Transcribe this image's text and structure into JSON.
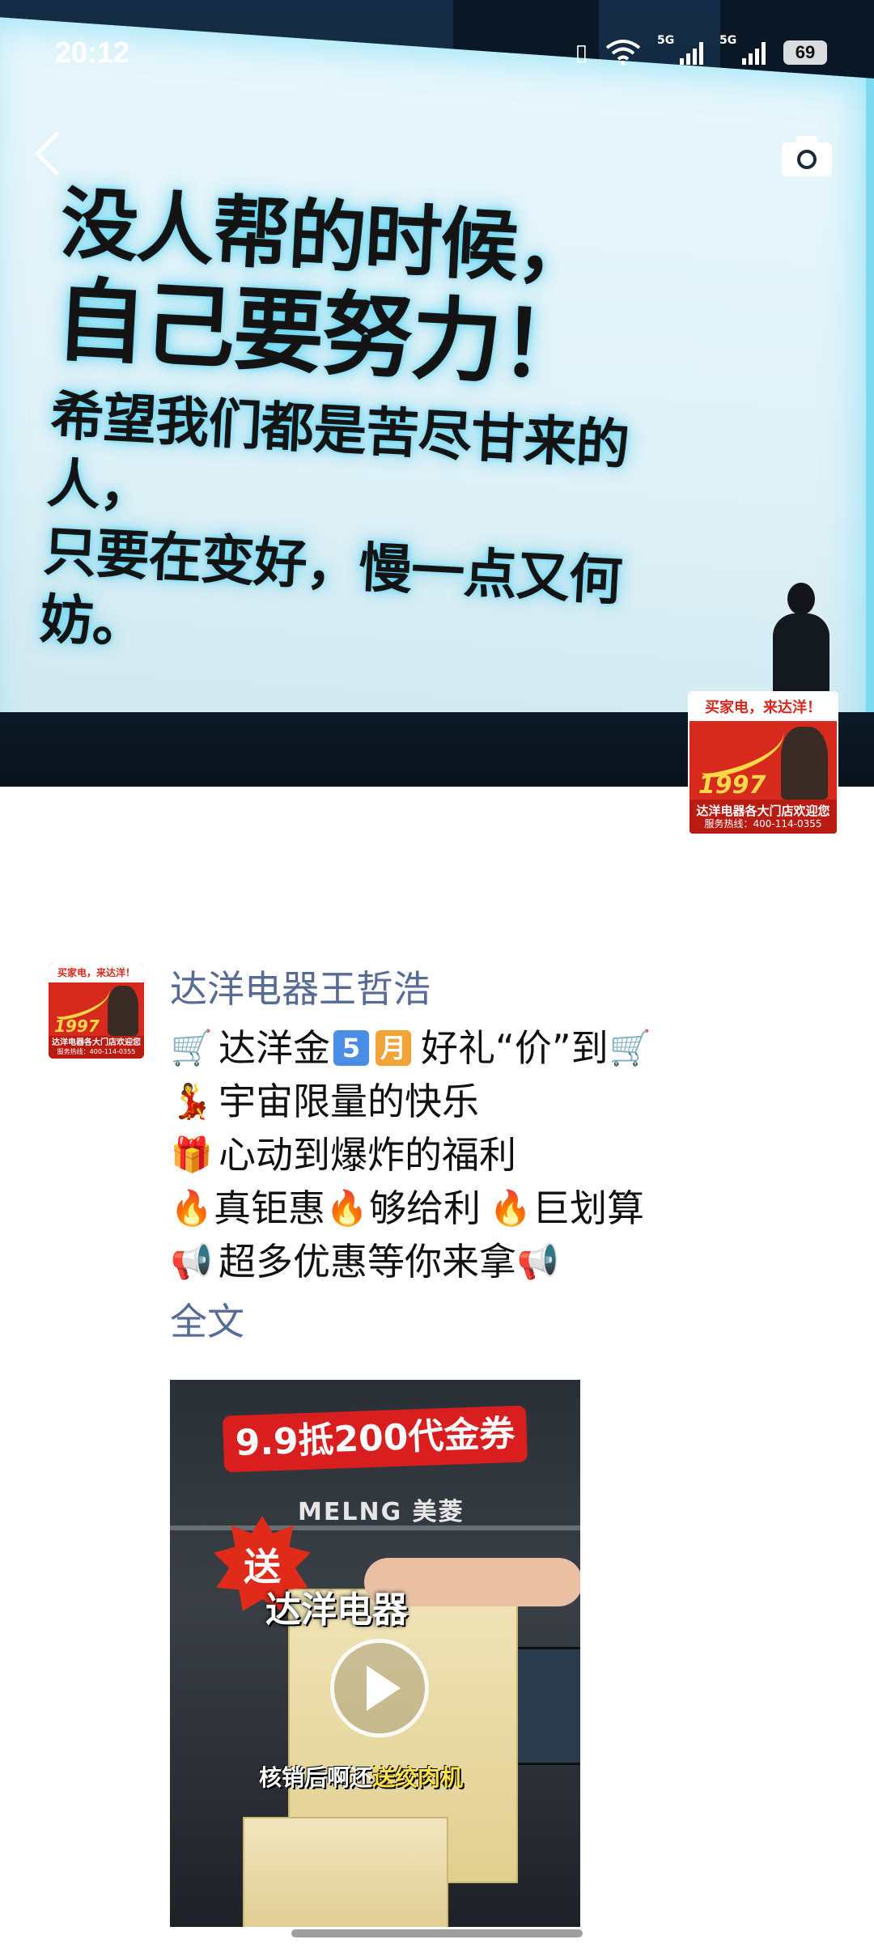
{
  "status_bar": {
    "time": "20:12",
    "network_1": "5G",
    "network_2": "5G",
    "battery": "69"
  },
  "cover": {
    "line1": "没人帮的时候，",
    "line2": "自己要努力！",
    "line3": "希望我们都是苦尽甘来的人，",
    "line4": "只要在变好，慢一点又何妨。"
  },
  "logo": {
    "top_text": "买家电，来达洋！",
    "year": "1997",
    "bottom_text": "达洋电器各大门店欢迎您",
    "hotline": "服务热线：400-114-0355"
  },
  "post": {
    "author": "达洋电器王哲浩",
    "lines": [
      {
        "pre_emoji": "🛒",
        "text_a": "达洋金",
        "badge_num": "5",
        "badge_month": "月",
        "text_b": "好礼“价”到",
        "post_emoji": "🛒"
      },
      {
        "emoji": "💃",
        "text": "宇宙限量的快乐"
      },
      {
        "emoji": "🎁",
        "text": "心动到爆炸的福利"
      },
      {
        "e1": "🔥",
        "t1": "真钜惠",
        "e2": "🔥",
        "t2": "够给利",
        "e3": "🔥",
        "t3": "巨划算"
      },
      {
        "emoji": "📢",
        "text": "超多优惠等你来拿",
        "post_emoji": "📢"
      }
    ],
    "full_text_link": "全文"
  },
  "video": {
    "title": "9.9抵200代金券",
    "store_sign": "MELNG 美菱",
    "star_text": "送",
    "caption": "达洋电器",
    "subtitle_a": "核销后啊还",
    "subtitle_b": "送绞肉机"
  },
  "colors": {
    "link": "#576b95",
    "brand_red": "#d62a1c",
    "board_glow": "#6ed8f2"
  }
}
